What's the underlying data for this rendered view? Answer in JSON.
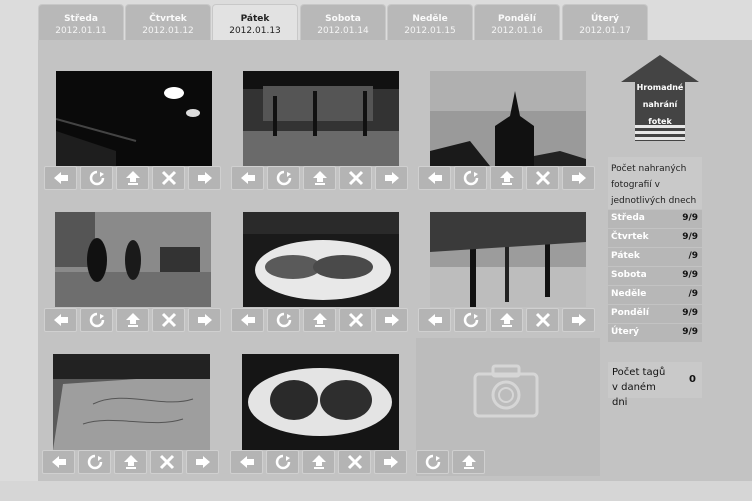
{
  "tabs": [
    {
      "day": "Středa",
      "date": "2012.01.11"
    },
    {
      "day": "Čtvrtek",
      "date": "2012.01.12"
    },
    {
      "day": "Pátek",
      "date": "2012.01.13",
      "active": true
    },
    {
      "day": "Sobota",
      "date": "2012.01.14"
    },
    {
      "day": "Neděle",
      "date": "2012.01.15"
    },
    {
      "day": "Pondělí",
      "date": "2012.01.16"
    },
    {
      "day": "Úterý",
      "date": "2012.01.17"
    }
  ],
  "upload": {
    "label": "Hromadné nahrání fotek"
  },
  "stats": {
    "heading": "Počet nahraných fotografií v jednotlivých dnech",
    "rows": [
      {
        "day": "Středa",
        "count": "9/9"
      },
      {
        "day": "Čtvrtek",
        "count": "9/9"
      },
      {
        "day": "Pátek",
        "count": "/9"
      },
      {
        "day": "Sobota",
        "count": "9/9"
      },
      {
        "day": "Neděle",
        "count": "/9"
      },
      {
        "day": "Pondělí",
        "count": "9/9"
      },
      {
        "day": "Úterý",
        "count": "9/9"
      }
    ]
  },
  "tags": {
    "label": "Počet tagů v daném dni",
    "value": "0"
  },
  "icons": {
    "buttons": [
      "arrow-left-icon",
      "rotate-icon",
      "upload-icon",
      "delete-icon",
      "arrow-right-icon"
    ],
    "empty_slot": "camera-icon"
  },
  "colors": {
    "background": "#dcdcdc",
    "panel": "#c3c3c3",
    "button": "#b4b4b4"
  }
}
